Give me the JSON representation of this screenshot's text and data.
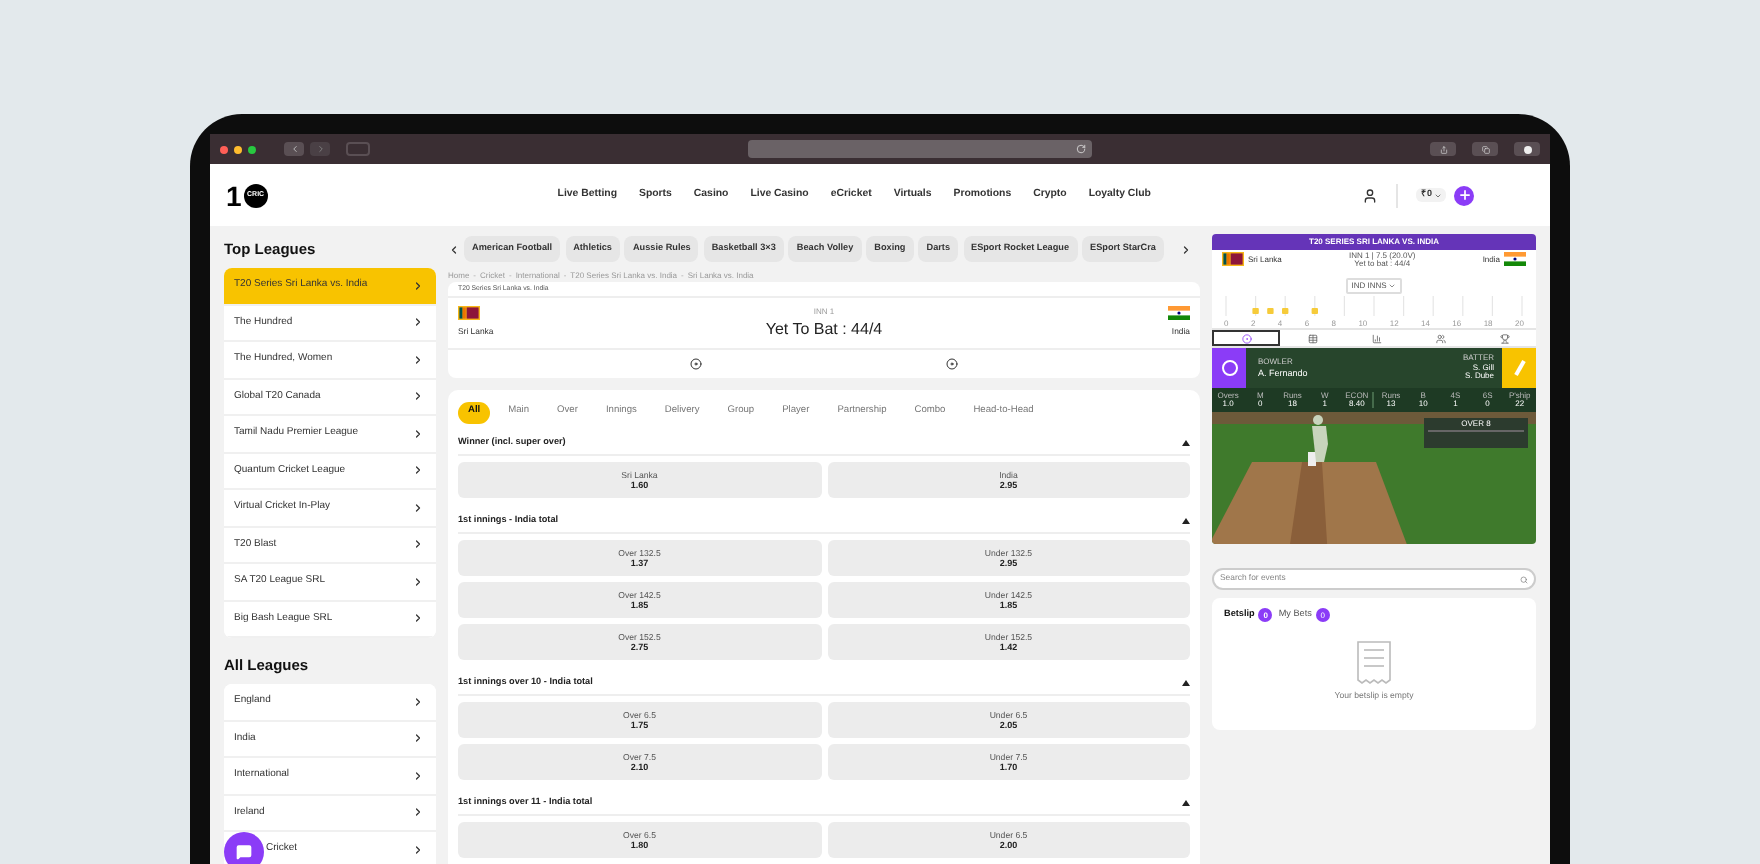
{
  "logo": {
    "numeral": "1",
    "mark": "CRIC"
  },
  "nav": [
    "Live Betting",
    "Sports",
    "Casino",
    "Live Casino",
    "eCricket",
    "Virtuals",
    "Promotions",
    "Crypto",
    "Loyalty Club"
  ],
  "currency": "₹0",
  "top_leagues": {
    "title": "Top Leagues",
    "items": [
      {
        "label": "T20 Series Sri Lanka vs. India",
        "selected": true
      },
      {
        "label": "The Hundred",
        "selected": false
      },
      {
        "label": "The Hundred, Women",
        "selected": false
      },
      {
        "label": "Global T20 Canada",
        "selected": false
      },
      {
        "label": "Tamil Nadu Premier League",
        "selected": false
      },
      {
        "label": "Quantum Cricket League",
        "selected": false
      },
      {
        "label": "Virtual Cricket In-Play",
        "selected": false
      },
      {
        "label": "T20 Blast",
        "selected": false
      },
      {
        "label": "SA T20 League SRL",
        "selected": false
      },
      {
        "label": "Big Bash League SRL",
        "selected": false
      }
    ]
  },
  "all_leagues": {
    "title": "All Leagues",
    "items": [
      {
        "label": "England",
        "selected": false
      },
      {
        "label": "India",
        "selected": false
      },
      {
        "label": "International",
        "selected": false
      },
      {
        "label": "Ireland",
        "selected": false
      },
      {
        "label": "Cricket",
        "selected": false
      }
    ]
  },
  "sport_tabs": [
    "American Football",
    "Athletics",
    "Aussie Rules",
    "Basketball 3×3",
    "Beach Volley",
    "Boxing",
    "Darts",
    "ESport Rocket League",
    "ESport StarCra"
  ],
  "breadcrumb_separator": "-",
  "breadcrumb": [
    "Home",
    "Cricket",
    "International",
    "T20 Series Sri Lanka vs. India",
    "Sri Lanka vs. India"
  ],
  "match": {
    "competition": "T20 Series Sri Lanka vs. India",
    "period": "INN 1",
    "score": "Yet To Bat : 44/4",
    "home": "Sri Lanka",
    "away": "India"
  },
  "market_filters": [
    {
      "label": "All",
      "selected": true
    },
    {
      "label": "Main",
      "selected": false
    },
    {
      "label": "Over",
      "selected": false
    },
    {
      "label": "Innings",
      "selected": false
    },
    {
      "label": "Delivery",
      "selected": false
    },
    {
      "label": "Group",
      "selected": false
    },
    {
      "label": "Player",
      "selected": false
    },
    {
      "label": "Partnership",
      "selected": false
    },
    {
      "label": "Combo",
      "selected": false
    },
    {
      "label": "Head-to-Head",
      "selected": false
    }
  ],
  "markets": [
    {
      "title": "Winner (incl. super over)",
      "expanded": true,
      "outcomes": [
        {
          "label": "Sri Lanka",
          "odds": "1.60"
        },
        {
          "label": "India",
          "odds": "2.95"
        }
      ]
    },
    {
      "title": "1st innings - India total",
      "expanded": true,
      "outcomes": [
        {
          "label": "Over 132.5",
          "odds": "1.37"
        },
        {
          "label": "Under 132.5",
          "odds": "2.95"
        },
        {
          "label": "Over 142.5",
          "odds": "1.85"
        },
        {
          "label": "Under 142.5",
          "odds": "1.85"
        },
        {
          "label": "Over 152.5",
          "odds": "2.75"
        },
        {
          "label": "Under 152.5",
          "odds": "1.42"
        }
      ]
    },
    {
      "title": "1st innings over 10 - India total",
      "expanded": true,
      "outcomes": [
        {
          "label": "Over 6.5",
          "odds": "1.75"
        },
        {
          "label": "Under 6.5",
          "odds": "2.05"
        },
        {
          "label": "Over 7.5",
          "odds": "2.10"
        },
        {
          "label": "Under 7.5",
          "odds": "1.70"
        }
      ]
    },
    {
      "title": "1st innings over 11 - India total",
      "expanded": true,
      "outcomes": [
        {
          "label": "Over 6.5",
          "odds": "1.80"
        },
        {
          "label": "Under 6.5",
          "odds": "2.00"
        }
      ]
    }
  ],
  "tracker": {
    "title": "T20 SERIES SRI LANKA VS. INDIA",
    "home": "Sri Lanka",
    "away": "India",
    "innings": "INN 1 | 7.5 (20.0V)",
    "status": "Yet to bat : 44/4",
    "selector": "IND INNS",
    "over_labels": [
      "0",
      "2",
      "4",
      "6",
      "8",
      "10",
      "12",
      "14",
      "16",
      "18",
      "20"
    ],
    "bowler_label": "BOWLER",
    "bowler": "A. Fernando",
    "batter_label": "BATTER",
    "batters": [
      "S. Gill",
      "S. Dube"
    ],
    "stats": [
      {
        "label": "Overs",
        "value": "1.0"
      },
      {
        "label": "M",
        "value": "0"
      },
      {
        "label": "Runs",
        "value": "18"
      },
      {
        "label": "W",
        "value": "1"
      },
      {
        "label": "ECON",
        "value": "8.40"
      },
      {
        "label": "Runs",
        "value": "13"
      },
      {
        "label": "B",
        "value": "10"
      },
      {
        "label": "4S",
        "value": "1"
      },
      {
        "label": "6S",
        "value": "0"
      },
      {
        "label": "P'ship",
        "value": "22"
      }
    ],
    "over_box": "OVER 8"
  },
  "search": {
    "placeholder": "Search for events"
  },
  "betslip": {
    "tabs": [
      {
        "label": "Betslip",
        "count": "0",
        "selected": true
      },
      {
        "label": "My Bets",
        "count": "0",
        "selected": false
      }
    ],
    "empty_message": "Your betslip is empty"
  }
}
